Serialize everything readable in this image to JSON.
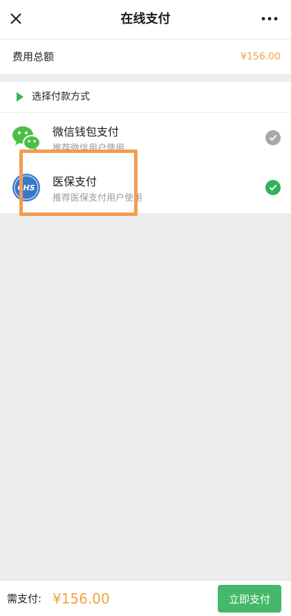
{
  "nav": {
    "title": "在线支付",
    "close_icon": "close-icon",
    "more_icon": "more-icon"
  },
  "fee": {
    "label": "费用总额",
    "amount": "¥156.00"
  },
  "section": {
    "title": "选择付款方式",
    "icon": "play-icon"
  },
  "methods": [
    {
      "name": "微信钱包支付",
      "desc": "推荐微信用户使用",
      "icon": "wechat-icon",
      "selected": false
    },
    {
      "name": "医保支付",
      "desc": "推荐医保支付用户使用",
      "icon": "chs-icon",
      "icon_text": "CHS",
      "selected": true
    }
  ],
  "footer": {
    "need_pay_label": "需支付:",
    "need_pay_amount": "¥156.00",
    "pay_button": "立即支付"
  },
  "colors": {
    "accent_orange": "#f0a341",
    "accent_green": "#46b86a",
    "highlight": "#f39c4f",
    "check_selected": "#2fb45a",
    "check_unselected": "#a8a8a8"
  }
}
